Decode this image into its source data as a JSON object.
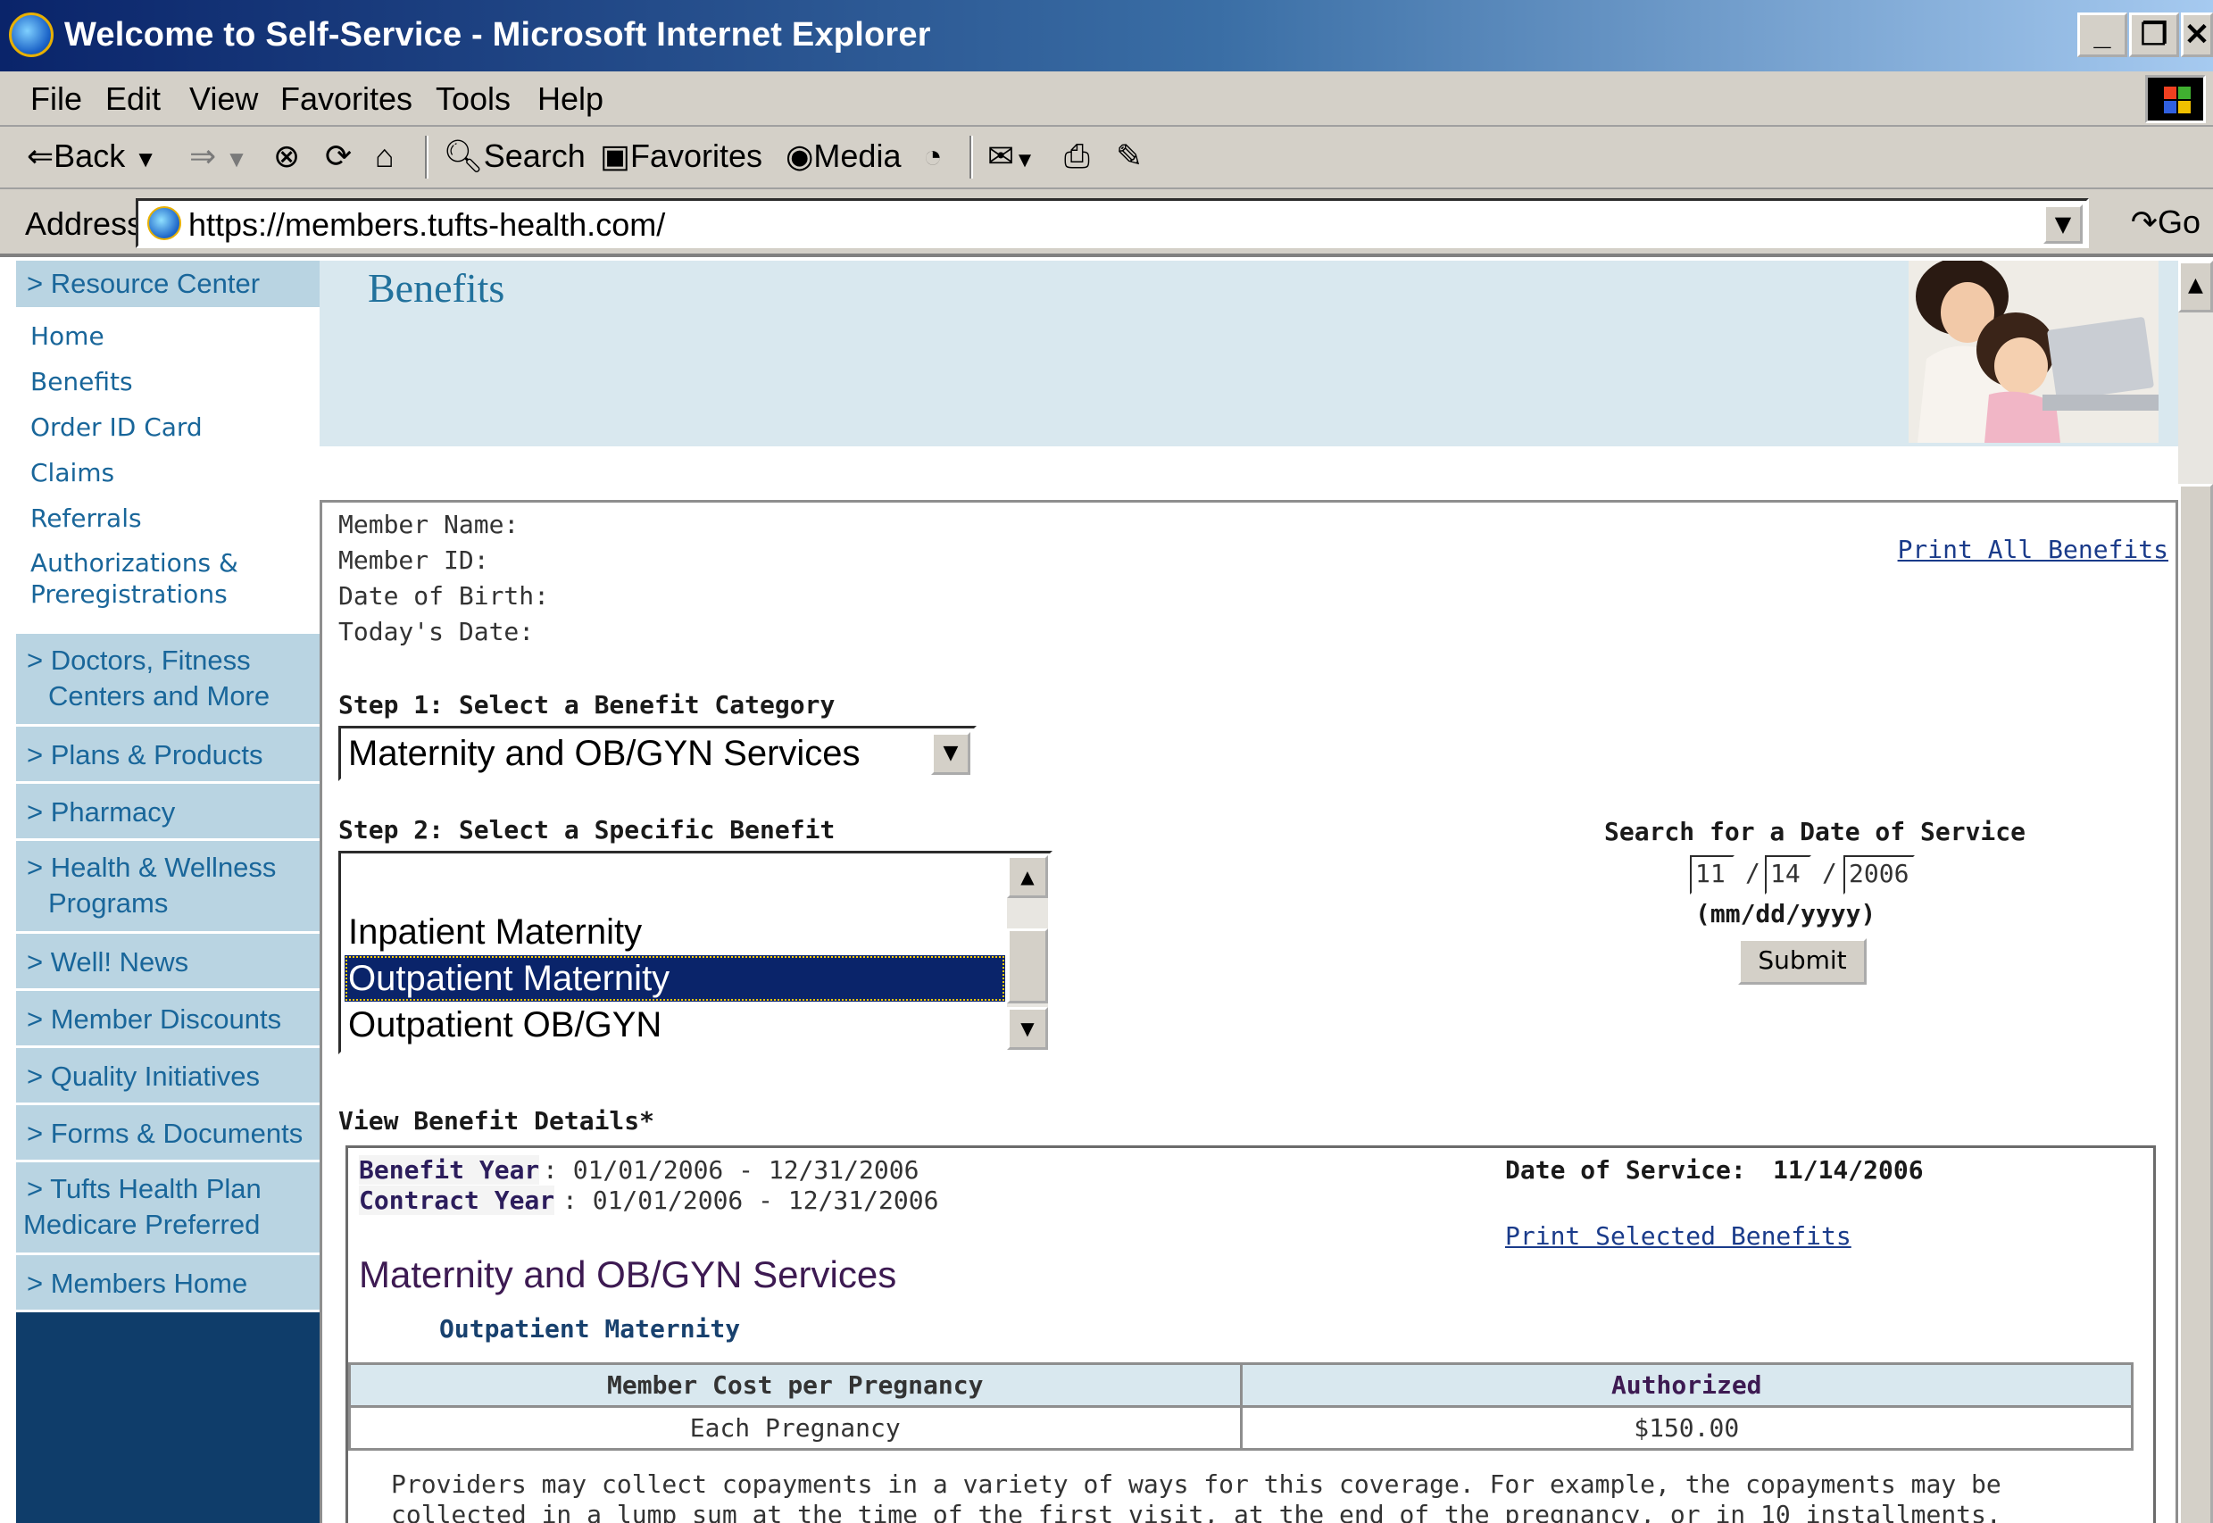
{
  "window": {
    "title": "Welcome to Self-Service - Microsoft Internet Explorer"
  },
  "menu": [
    "File",
    "Edit",
    "View",
    "Favorites",
    "Tools",
    "Help"
  ],
  "toolbar": {
    "back": "Back",
    "search": "Search",
    "favorites": "Favorites",
    "media": "Media"
  },
  "address": {
    "label": "Address",
    "url": "https://members.tufts-health.com/",
    "go": "Go"
  },
  "sidebar": {
    "resource_center": "> Resource Center",
    "links": [
      "Home",
      "Benefits",
      "Order ID Card",
      "Claims",
      "Referrals",
      "Authorizations &",
      "Preregistrations"
    ],
    "sections": [
      {
        "line1": "> Doctors, Fitness",
        "line2": "Centers and More"
      },
      {
        "line1": "> Plans & Products"
      },
      {
        "line1": "> Pharmacy"
      },
      {
        "line1": "> Health & Wellness",
        "line2": "Programs"
      },
      {
        "line1": "> Well! News"
      },
      {
        "line1": "> Member Discounts"
      },
      {
        "line1": "> Quality Initiatives"
      },
      {
        "line1": "> Forms & Documents"
      },
      {
        "line1": "> Tufts Health Plan",
        "line2": "Medicare Preferred"
      },
      {
        "line1": "> Members Home"
      }
    ]
  },
  "header": {
    "title": "Benefits"
  },
  "member": {
    "name_label": "Member Name:",
    "id_label": "Member ID:",
    "dob_label": "Date of Birth:",
    "today_label": "Today's Date:",
    "print_all": "Print All Benefits"
  },
  "step1": {
    "label": "Step 1: Select a Benefit Category",
    "selected": "Maternity and OB/GYN Services"
  },
  "step2": {
    "label": "Step 2: Select a Specific Benefit",
    "options": [
      "Inpatient Maternity",
      "Outpatient Maternity",
      "Outpatient OB/GYN"
    ],
    "selected": "Outpatient Maternity"
  },
  "date_search": {
    "label": "Search for a Date of Service",
    "mm": "11",
    "dd": "14",
    "yyyy": "2006",
    "format": "(mm/dd/yyyy)",
    "submit": "Submit"
  },
  "details": {
    "heading": "View Benefit Details*",
    "benefit_year_label": "Benefit Year",
    "benefit_year": ": 01/01/2006 - 12/31/2006",
    "contract_year_label": "Contract Year",
    "contract_year": ": 01/01/2006 - 12/31/2006",
    "date_of_service_label": "Date of Service:",
    "date_of_service": "11/14/2006",
    "print_selected": "Print Selected Benefits",
    "category": "Maternity and OB/GYN Services",
    "subcategory": "Outpatient Maternity",
    "table": {
      "headers": [
        "Member Cost per Pregnancy",
        "Authorized"
      ],
      "rows": [
        [
          "Each Pregnancy",
          "$150.00"
        ]
      ]
    },
    "note": "Providers may collect copayments in a variety of ways for this coverage. For example, the copayments may be collected in a lump sum at the time of the first visit, at the end of the pregnancy, or in 10 installments."
  }
}
